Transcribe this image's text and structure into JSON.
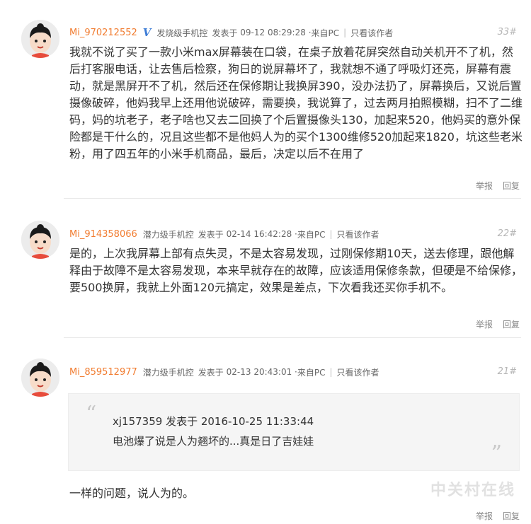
{
  "posts": [
    {
      "username": "Mi_970212552",
      "verified_badge": "V",
      "level": "发烧级手机控",
      "posted_prefix": "发表于",
      "datetime": "09-12 08:29:28",
      "source": "来自PC",
      "only_author": "只看该作者",
      "floor": "33#",
      "content": "我就不说了买了一款小米max屏幕装在口袋，在桌子放着花屏突然自动关机开不了机，然后打客服电话，让去售后检察，狗日的说屏幕坏了，我就想不通了呼吸灯还亮，屏幕有震动，就是黑屏开不了机，然后还在保修期让我换屏390，没办法扔了，屏幕换后，又说后置摄像破碎，他妈我早上还用他说破碎，需要换，我说算了，过去两月拍照模糊，扫不了二维码，妈的坑老子，老子啥也又去二回换了个后置摄像头130，加起来520，他妈买的意外保险都是干什么的，况且这些都不是他妈人为的买个1300维修520加起来1820，坑这些老米粉，用了四五年的小米手机商品，最后，决定以后不在用了",
      "report": "举报",
      "reply": "回复"
    },
    {
      "username": "Mi_914358066",
      "level": "潜力级手机控",
      "posted_prefix": "发表于",
      "datetime": "02-14 16:42:28",
      "source": "来自PC",
      "only_author": "只看该作者",
      "floor": "22#",
      "content": "是的，上次我屏幕上部有点失灵，不是太容易发现，过刚保修期10天，送去修理，跟他解释由于故障不是太容易发现，本来早就存在的故障，应该适用保修条款，但硬是不给保修，要500换屏，我就上外面120元搞定，效果是差点，下次看我还买你手机不。",
      "report": "举报",
      "reply": "回复"
    },
    {
      "username": "Mi_859512977",
      "level": "潜力级手机控",
      "posted_prefix": "发表于",
      "datetime": "02-13 20:43:01",
      "source": "来自PC",
      "only_author": "只看该作者",
      "floor": "21#",
      "quote": {
        "author_line": "xj157359 发表于 2016-10-25 11:33:44",
        "text": "电池爆了说是人为翘坏的...真是日了吉娃娃"
      },
      "content": "一样的问题，说人为的。",
      "report": "举报",
      "reply": "回复"
    }
  ],
  "watermark": "中关村在线"
}
